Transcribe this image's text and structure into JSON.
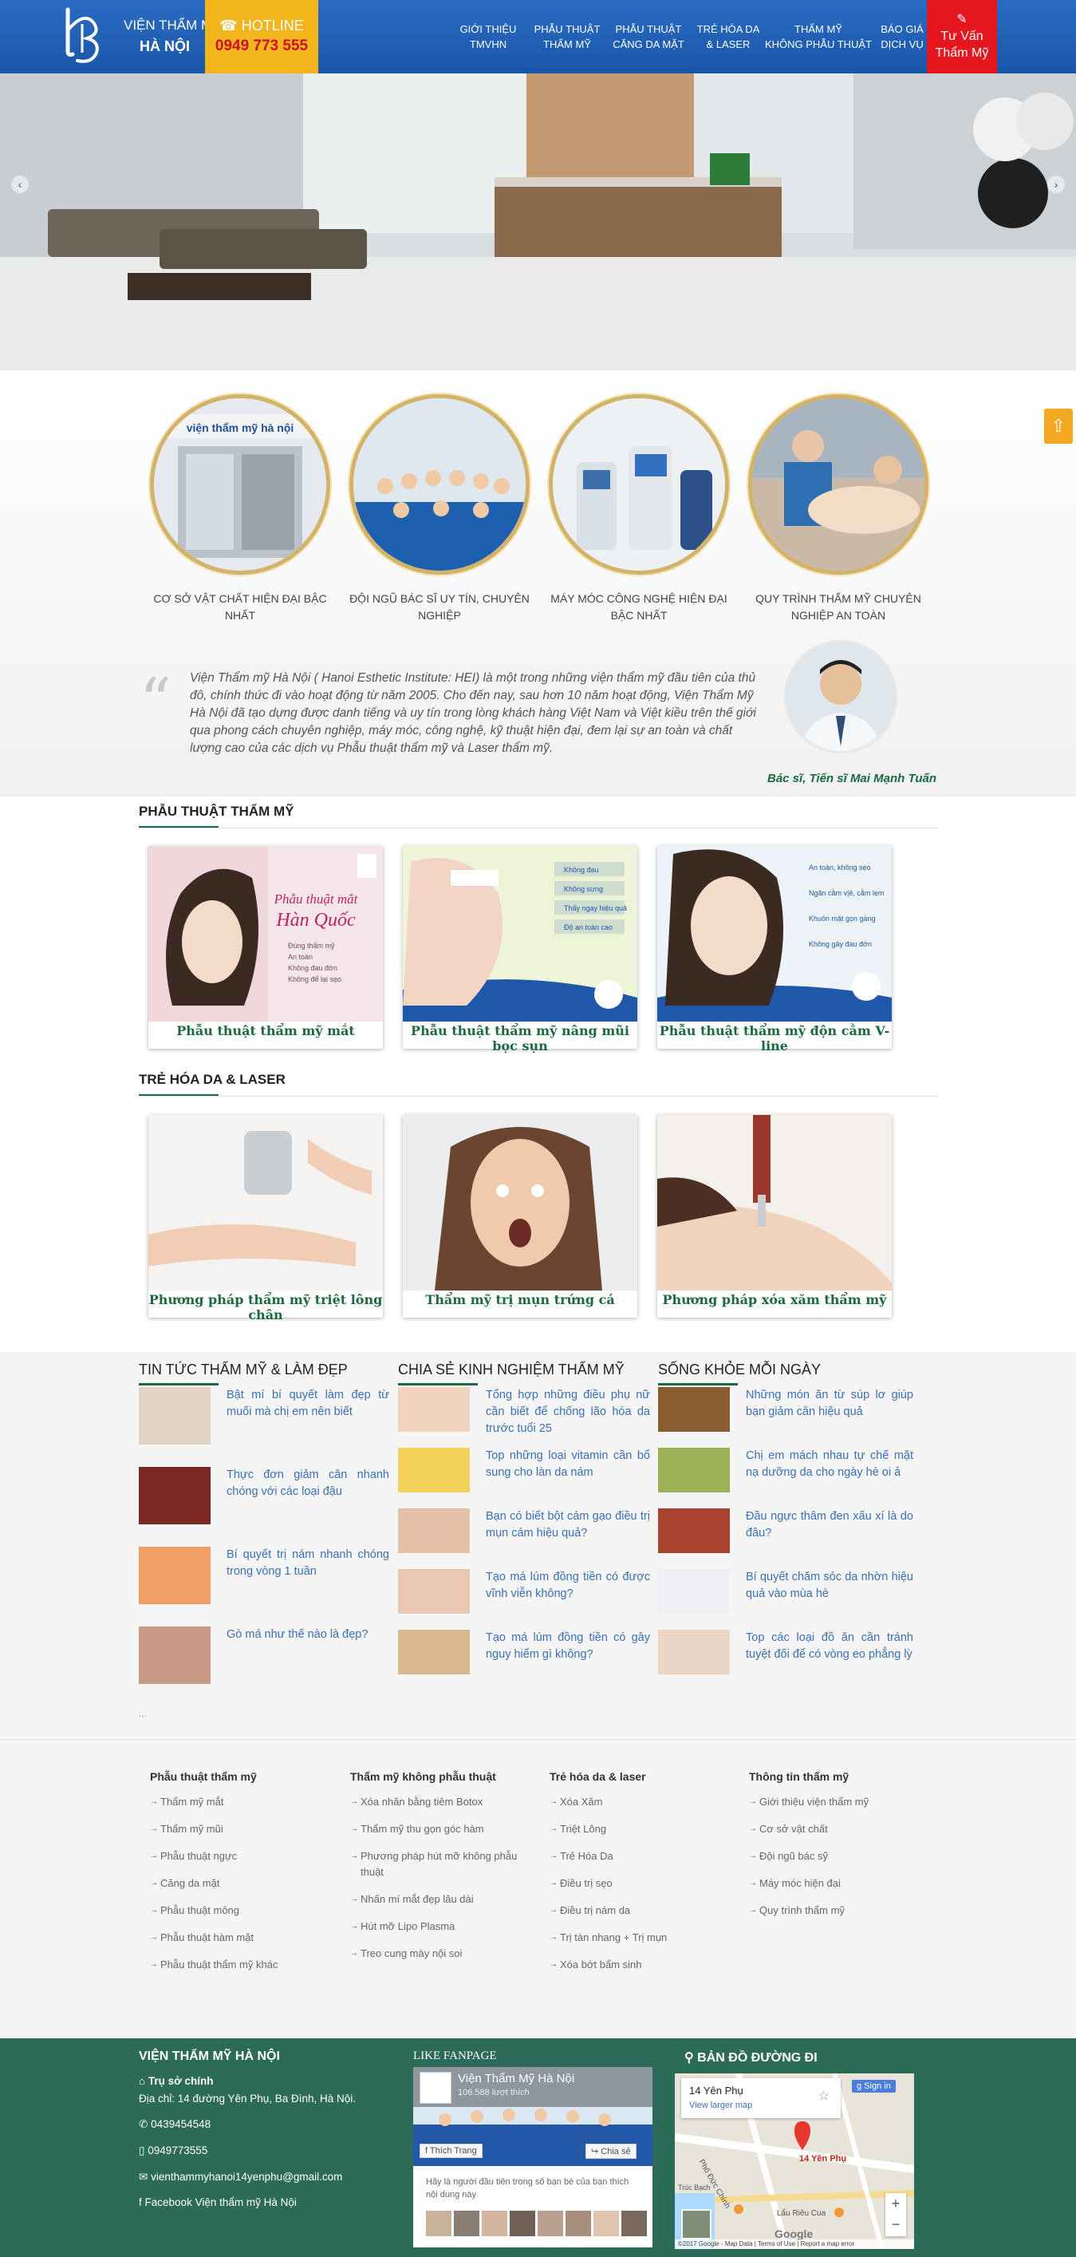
{
  "header": {
    "logo_line1": "VIỆN THẨM MỸ",
    "logo_line2": "HÀ NỘI",
    "hotline_label": "HOTLINE",
    "hotline_number": "0949 773 555",
    "nav": [
      {
        "line1": "GIỚI THIỆU",
        "line2": "TMVHN"
      },
      {
        "line1": "PHẪU THUẬT",
        "line2": "THẨM MỸ"
      },
      {
        "line1": "PHẪU THUẬT",
        "line2": "CĂNG DA MẶT"
      },
      {
        "line1": "TRẺ HÓA DA",
        "line2": "& LASER"
      },
      {
        "line1": "THẨM MỸ",
        "line2": "KHÔNG PHẪU THUẬT"
      },
      {
        "line1": "BÁO GIÁ",
        "line2": "DỊCH VỤ"
      }
    ],
    "consult_line1": "Tư Vấn",
    "consult_line2": "Thẩm Mỹ"
  },
  "features": [
    {
      "label": "CƠ SỞ VẬT CHẤT HIỆN ĐẠI BẬC NHẤT",
      "sign": "viện thẩm mỹ hà nội"
    },
    {
      "label": "ĐỘI NGŨ BÁC SĨ UY TÍN, CHUYÊN NGHIỆP"
    },
    {
      "label": "MÁY MÓC CÔNG NGHỆ HIỆN ĐẠI BẬC NHẤT"
    },
    {
      "label": "QUY TRÌNH THẨM MỸ CHUYÊN NGHIỆP AN TOÀN"
    }
  ],
  "intro": {
    "text": "Viện Thẩm mỹ Hà Nội ( Hanoi Esthetic Institute: HEI) là một trong những viện thẩm mỹ đầu tiên của thủ đô, chính thức đi vào hoạt động từ năm 2005. Cho đến nay, sau hơn 10 năm hoạt động, Viện Thẩm Mỹ Hà Nội đã tạo dựng được danh tiếng và uy tín trong lòng khách hàng Việt Nam và Việt kiều trên thế giới qua phong cách chuyên nghiệp, máy móc, công nghệ, kỹ thuật hiện đại, đem lại sự an toàn và chất lượng cao của các dịch vụ Phẫu thuật thẩm mỹ và Laser thẩm mỹ.",
    "doctor": "Bác sĩ, Tiến sĩ Mai Mạnh Tuấn"
  },
  "surgery": {
    "title": "PHẪU THUẬT THẨM MỸ",
    "cards": [
      {
        "label": "Phẫu thuật thẩm mỹ mắt",
        "img_title": "Phẫu thuật mắt",
        "img_sub": "Hàn Quốc",
        "bullets": [
          "Đúng thẩm mỹ",
          "An toàn",
          "Không đau đớn",
          "Không để lại sẹo"
        ]
      },
      {
        "label": "Phẫu thuật thẩm mỹ nâng mũi bọc sụn",
        "bullets": [
          "Không đau",
          "Không sưng",
          "Thấy ngay hiệu quả",
          "Độ an toàn cao"
        ]
      },
      {
        "label": "Phẫu thuật thẩm mỹ độn cằm V-line",
        "bullets": [
          "An toàn, không sẹo",
          "Ngăn cằm v|ê, cằm lẹm",
          "Khuôn mặt gọn gàng",
          "Không gây đau đớn"
        ]
      }
    ]
  },
  "laser": {
    "title": "TRẺ HÓA DA & LASER",
    "cards": [
      {
        "label": "Phương pháp thẩm mỹ triệt lông chân"
      },
      {
        "label": "Thẩm mỹ trị mụn trứng cá"
      },
      {
        "label": "Phương pháp xóa xăm thẩm mỹ"
      }
    ]
  },
  "news": {
    "col1_title": "TIN TỨC THẨM MỸ & LÀM ĐẸP",
    "col2_title": "CHIA SẺ KINH NGHIỆM THẨM MỸ",
    "col3_title": "SỐNG KHỎE MỖI NGÀY",
    "col1": [
      "Bật mí bí quyết làm đẹp từ muối mà chị em nên biết",
      "Thực đơn giảm cân nhanh chóng với các loại đậu",
      "Bí quyết trị nám nhanh chóng trong vòng 1 tuần",
      "Gò má như thế nào là đẹp?"
    ],
    "col2": [
      "Tổng hợp những điều phụ nữ cần biết để chống lão hóa da trước tuổi 25",
      "Top những loại vitamin cần bổ sung cho làn da nám",
      "Bạn có biết bột cám gạo điều trị mụn cám hiệu quả?",
      "Tạo má lúm đồng tiền có được vĩnh viễn không?",
      "Tạo má lúm đồng tiền có gây nguy hiểm gì không?"
    ],
    "col3": [
      "Những món ăn từ súp lơ giúp bạn giảm cân hiệu quả",
      "Chị em mách nhau tự chế mặt nạ dưỡng da cho ngày hè oi ả",
      "Đầu ngực thâm đen xấu xí là do đâu?",
      "Bí quyết chăm sóc da nhờn hiệu quả vào mùa hè",
      "Top các loại đồ ăn cần tránh tuyệt đối để có vòng eo phẳng lỳ"
    ],
    "ellipsis": "..."
  },
  "footer_links": [
    {
      "title": "Phẫu thuật thẩm mỹ",
      "items": [
        "Thẩm mỹ mắt",
        "Thẩm mỹ mũi",
        "Phẫu thuật ngực",
        "Căng da mặt",
        "Phẫu thuật mông",
        "Phẫu thuật hàm mặt",
        "Phẫu thuật thẩm mỹ khác"
      ]
    },
    {
      "title": "Thẩm mỹ không phẫu thuật",
      "items": [
        "Xóa nhăn bằng tiêm Botox",
        "Thẩm mỹ thu gọn góc hàm",
        "Phương pháp hút mỡ không phẫu thuật",
        "Nhấn mí mắt đẹp lâu dài",
        "Hút mỡ Lipo Plasma",
        "Treo cung mày nội soi"
      ]
    },
    {
      "title": "Trẻ hóa da & laser",
      "items": [
        "Xóa Xăm",
        "Triệt Lông",
        "Trẻ Hóa Da",
        "Điều trị sẹo",
        "Điều trị nám da",
        "Trị tàn nhang + Trị mụn",
        "Xóa bớt bẩm sinh"
      ]
    },
    {
      "title": "Thông tin thẩm mỹ",
      "items": [
        "Giới thiệu viện thẩm mỹ",
        "Cơ sở vật chất",
        "Đội ngũ bác sỹ",
        "Máy móc hiện đại",
        "Quy trình thẩm mỹ"
      ]
    }
  ],
  "footer": {
    "org_title": "VIỆN THẨM MỸ HÀ NỘI",
    "hq_label": "Trụ sở chính",
    "address": "Địa chỉ: 14 đường Yên Phụ, Ba Đình, Hà Nội.",
    "phone1": "0439454548",
    "phone2": "0949773555",
    "email": "vienthammyhanoi14yenphu@gmail.com",
    "facebook": "Facebook Viện thẩm mỹ Hà Nội",
    "fanpage_title": "LIKE FANPAGE",
    "fb_page_name": "Viện Thẩm Mỹ Hà Nội",
    "fb_likes": "106.588 lượt thích",
    "fb_like_btn": "Thích Trang",
    "fb_share_btn": "Chia sẻ",
    "fb_note": "Hãy là người đầu tiên trong số bạn bè của bạn thích nội dung này",
    "map_title": "BẢN ĐỒ ĐƯỜNG ĐI",
    "map_place": "14 Yên Phụ",
    "map_larger": "View larger map",
    "map_sign_in": "Sign in",
    "map_pin_label": "14 Yên Phụ",
    "map_street": "Phố Đức Chính",
    "map_street2": "Trúc Bạch",
    "map_poi": "Lẩu Riêu Cua",
    "map_google": "Google",
    "map_copyright": "©2017 Google - Map Data",
    "map_terms": "Terms of Use",
    "map_report": "Report a map error"
  }
}
